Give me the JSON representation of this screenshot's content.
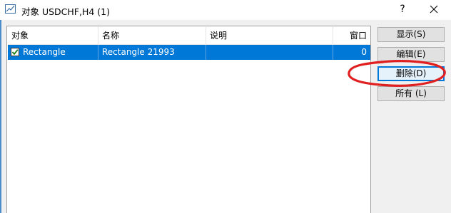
{
  "window": {
    "title": "对象 USDCHF,H4 (1)",
    "help_label": "?",
    "accent_color": "#0078d7"
  },
  "table": {
    "columns": [
      "对象",
      "名称",
      "说明",
      "窗口"
    ],
    "rows": [
      {
        "checked": true,
        "object": "Rectangle",
        "name": "Rectangle 21993",
        "description": "",
        "window": "0"
      }
    ]
  },
  "buttons": {
    "show": "显示(S)",
    "edit": "编辑(E)",
    "delete": "删除(D)",
    "all": "所有 (L)"
  },
  "annotation": {
    "shape": "ellipse",
    "color": "#e02020",
    "target": "delete-button"
  },
  "icons": {
    "app": "chart-icon",
    "close": "close-icon",
    "check": "checkmark-icon"
  }
}
